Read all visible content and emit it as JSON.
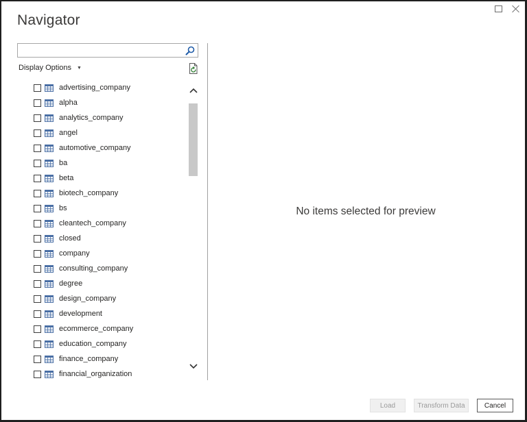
{
  "window": {
    "title": "Navigator",
    "controls": [
      "maximize-icon",
      "close-icon"
    ]
  },
  "search": {
    "value": "",
    "placeholder": "",
    "icon": "search-icon"
  },
  "display_options": {
    "label": "Display Options",
    "icon": "chevron-down-icon"
  },
  "refresh": {
    "icon": "refresh-icon"
  },
  "items": [
    {
      "label": "advertising_company",
      "checked": false
    },
    {
      "label": "alpha",
      "checked": false
    },
    {
      "label": "analytics_company",
      "checked": false
    },
    {
      "label": "angel",
      "checked": false
    },
    {
      "label": "automotive_company",
      "checked": false
    },
    {
      "label": "ba",
      "checked": false
    },
    {
      "label": "beta",
      "checked": false
    },
    {
      "label": "biotech_company",
      "checked": false
    },
    {
      "label": "bs",
      "checked": false
    },
    {
      "label": "cleantech_company",
      "checked": false
    },
    {
      "label": "closed",
      "checked": false
    },
    {
      "label": "company",
      "checked": false
    },
    {
      "label": "consulting_company",
      "checked": false
    },
    {
      "label": "degree",
      "checked": false
    },
    {
      "label": "design_company",
      "checked": false
    },
    {
      "label": "development",
      "checked": false
    },
    {
      "label": "ecommerce_company",
      "checked": false
    },
    {
      "label": "education_company",
      "checked": false
    },
    {
      "label": "finance_company",
      "checked": false
    },
    {
      "label": "financial_organization",
      "checked": false
    }
  ],
  "preview": {
    "empty_message": "No items selected for preview"
  },
  "buttons": {
    "load": "Load",
    "transform": "Transform Data",
    "cancel": "Cancel"
  },
  "colors": {
    "table_icon": "#4a6fa5",
    "search_icon": "#1e5ba8",
    "refresh_icon": "#2e7d32"
  }
}
